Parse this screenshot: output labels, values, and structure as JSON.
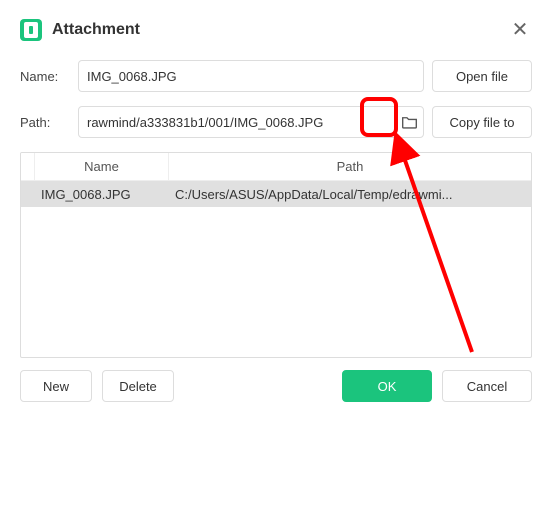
{
  "dialog": {
    "title": "Attachment"
  },
  "fields": {
    "name_label": "Name:",
    "name_value": "IMG_0068.JPG",
    "path_label": "Path:",
    "path_value": "rawmind/a333831b1/001/IMG_0068.JPG"
  },
  "buttons": {
    "open_file": "Open file",
    "copy_file_to": "Copy file to",
    "new": "New",
    "delete": "Delete",
    "ok": "OK",
    "cancel": "Cancel"
  },
  "table": {
    "headers": {
      "name": "Name",
      "path": "Path"
    },
    "rows": [
      {
        "name": "IMG_0068.JPG",
        "path": "C:/Users/ASUS/AppData/Local/Temp/edrawmi..."
      }
    ]
  }
}
